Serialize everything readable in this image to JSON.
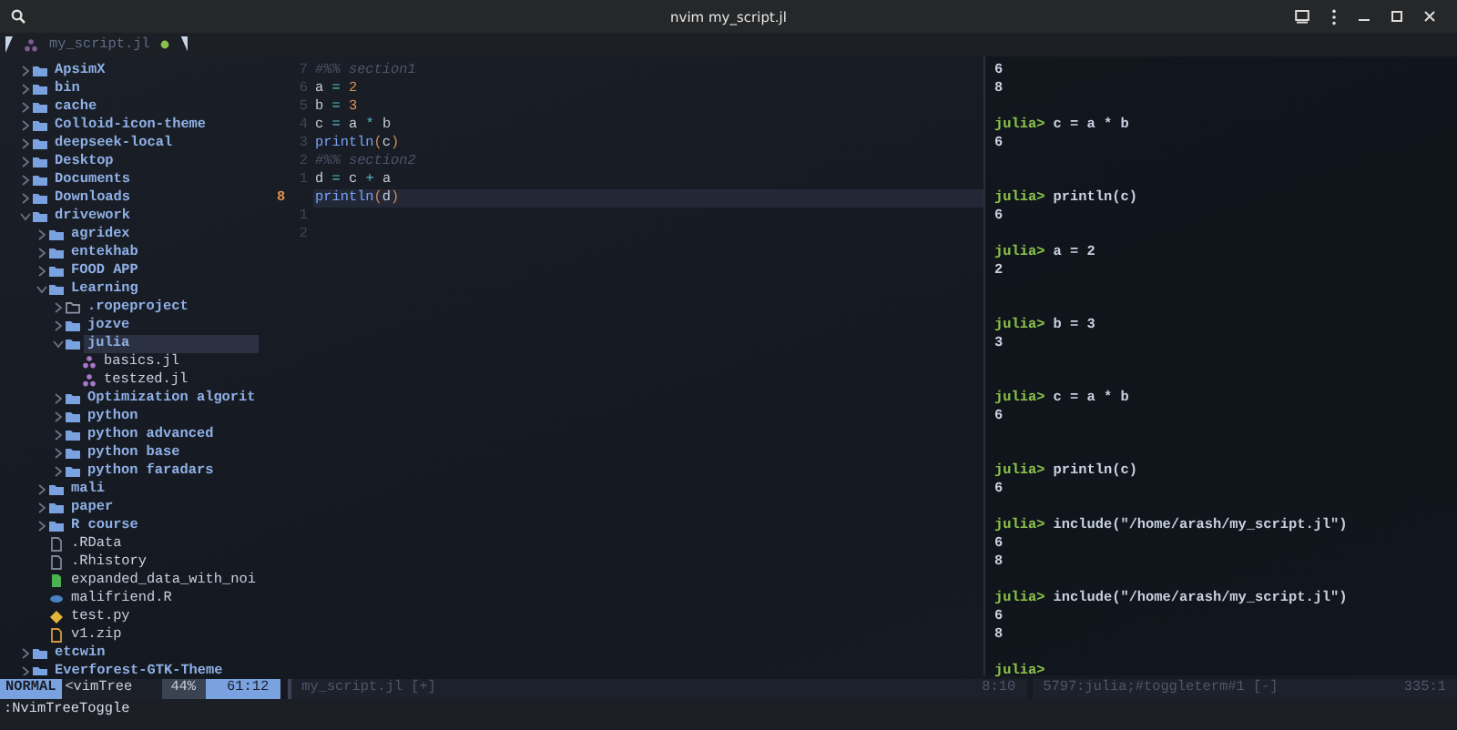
{
  "window": {
    "title": "nvim my_script.jl"
  },
  "tab": {
    "label": "my_script.jl",
    "modified": true
  },
  "tree": [
    {
      "name": "ApsimX",
      "kind": "folder",
      "expanded": false,
      "selected": false
    },
    {
      "name": "bin",
      "kind": "folder",
      "expanded": false,
      "selected": false
    },
    {
      "name": "cache",
      "kind": "folder",
      "expanded": false,
      "selected": false
    },
    {
      "name": "Colloid-icon-theme",
      "kind": "folder",
      "expanded": false,
      "selected": false
    },
    {
      "name": "deepseek-local",
      "kind": "folder",
      "expanded": false,
      "selected": false
    },
    {
      "name": "Desktop",
      "kind": "folder",
      "expanded": false,
      "selected": false
    },
    {
      "name": "Documents",
      "kind": "folder",
      "expanded": false,
      "selected": false
    },
    {
      "name": "Downloads",
      "kind": "folder",
      "expanded": false,
      "selected": false
    },
    {
      "name": "drivework",
      "kind": "folder",
      "expanded": true,
      "selected": false,
      "children": [
        {
          "name": "agridex",
          "kind": "folder",
          "expanded": false,
          "selected": false
        },
        {
          "name": "entekhab",
          "kind": "folder",
          "expanded": false,
          "selected": false
        },
        {
          "name": "FOOD APP",
          "kind": "folder",
          "expanded": false,
          "selected": false
        },
        {
          "name": "Learning",
          "kind": "folder",
          "expanded": true,
          "selected": false,
          "children": [
            {
              "name": ".ropeproject",
              "kind": "empty-folder",
              "expanded": false,
              "selected": false
            },
            {
              "name": "jozve",
              "kind": "folder",
              "expanded": false,
              "selected": false
            },
            {
              "name": "julia",
              "kind": "folder",
              "expanded": true,
              "selected": true,
              "children": [
                {
                  "name": "basics.jl",
                  "kind": "julia",
                  "selected": false
                },
                {
                  "name": "testzed.jl",
                  "kind": "julia",
                  "selected": false
                }
              ]
            },
            {
              "name": "Optimization algorit",
              "kind": "folder",
              "expanded": false,
              "selected": false
            },
            {
              "name": "python",
              "kind": "folder",
              "expanded": false,
              "selected": false
            },
            {
              "name": "python advanced",
              "kind": "folder",
              "expanded": false,
              "selected": false
            },
            {
              "name": "python base",
              "kind": "folder",
              "expanded": false,
              "selected": false
            },
            {
              "name": "python faradars",
              "kind": "folder",
              "expanded": false,
              "selected": false
            }
          ]
        },
        {
          "name": "mali",
          "kind": "folder",
          "expanded": false,
          "selected": false
        },
        {
          "name": "paper",
          "kind": "folder",
          "expanded": false,
          "selected": false
        },
        {
          "name": "R course",
          "kind": "folder",
          "expanded": false,
          "selected": false
        },
        {
          "name": ".RData",
          "kind": "data",
          "selected": false
        },
        {
          "name": ".Rhistory",
          "kind": "data",
          "selected": false
        },
        {
          "name": "expanded_data_with_noi",
          "kind": "csv",
          "selected": false
        },
        {
          "name": "malifriend.R",
          "kind": "r",
          "selected": false
        },
        {
          "name": "test.py",
          "kind": "python",
          "selected": false
        },
        {
          "name": "v1.zip",
          "kind": "zip",
          "selected": false
        }
      ]
    },
    {
      "name": "etcwin",
      "kind": "folder",
      "expanded": false,
      "selected": false
    },
    {
      "name": "Everforest-GTK-Theme",
      "kind": "folder",
      "expanded": false,
      "selected": false
    }
  ],
  "editor": {
    "lines": [
      {
        "number": "7",
        "current": false,
        "tokens": [
          {
            "text": "#%% section1",
            "kind": "comment"
          }
        ]
      },
      {
        "number": "6",
        "current": false,
        "tokens": [
          {
            "text": "a ",
            "kind": "ident"
          },
          {
            "text": "=",
            "kind": "op"
          },
          {
            "text": " 2",
            "kind": "number"
          }
        ]
      },
      {
        "number": "5",
        "current": false,
        "tokens": [
          {
            "text": "b ",
            "kind": "ident"
          },
          {
            "text": "=",
            "kind": "op"
          },
          {
            "text": " 3",
            "kind": "number"
          }
        ]
      },
      {
        "number": "4",
        "current": false,
        "tokens": [
          {
            "text": "c ",
            "kind": "ident"
          },
          {
            "text": "=",
            "kind": "op"
          },
          {
            "text": " a ",
            "kind": "ident"
          },
          {
            "text": "*",
            "kind": "op"
          },
          {
            "text": " b",
            "kind": "ident"
          }
        ]
      },
      {
        "number": "3",
        "current": false,
        "tokens": [
          {
            "text": "println",
            "kind": "func"
          },
          {
            "text": "(",
            "kind": "paren"
          },
          {
            "text": "c",
            "kind": "ident"
          },
          {
            "text": ")",
            "kind": "paren"
          }
        ]
      },
      {
        "number": "2",
        "current": false,
        "tokens": [
          {
            "text": "#%% section2",
            "kind": "comment"
          }
        ]
      },
      {
        "number": "1",
        "current": false,
        "tokens": [
          {
            "text": "d ",
            "kind": "ident"
          },
          {
            "text": "=",
            "kind": "op"
          },
          {
            "text": " c ",
            "kind": "ident"
          },
          {
            "text": "+",
            "kind": "op"
          },
          {
            "text": " a",
            "kind": "ident"
          }
        ]
      },
      {
        "number": "8",
        "current": true,
        "tokens": [
          {
            "text": "println",
            "kind": "func"
          },
          {
            "text": "(",
            "kind": "paren"
          },
          {
            "text": "d",
            "kind": "ident"
          },
          {
            "text": ")",
            "kind": "paren"
          }
        ]
      },
      {
        "number": "1",
        "current": false
      },
      {
        "number": "2",
        "current": false
      }
    ]
  },
  "terminal": {
    "lines": [
      {
        "kind": "output",
        "text": "6"
      },
      {
        "kind": "output",
        "text": "8"
      },
      {
        "kind": "blank"
      },
      {
        "kind": "input",
        "prompt": "julia>",
        "text": "c = a * b"
      },
      {
        "kind": "output",
        "text": "6"
      },
      {
        "kind": "blank"
      },
      {
        "kind": "blank"
      },
      {
        "kind": "input",
        "prompt": "julia>",
        "text": "println(c)"
      },
      {
        "kind": "output",
        "text": "6"
      },
      {
        "kind": "blank"
      },
      {
        "kind": "input",
        "prompt": "julia>",
        "text": "a = 2"
      },
      {
        "kind": "output",
        "text": "2"
      },
      {
        "kind": "blank"
      },
      {
        "kind": "blank"
      },
      {
        "kind": "input",
        "prompt": "julia>",
        "text": "b = 3"
      },
      {
        "kind": "output",
        "text": "3"
      },
      {
        "kind": "blank"
      },
      {
        "kind": "blank"
      },
      {
        "kind": "input",
        "prompt": "julia>",
        "text": "c = a * b"
      },
      {
        "kind": "output",
        "text": "6"
      },
      {
        "kind": "blank"
      },
      {
        "kind": "blank"
      },
      {
        "kind": "input",
        "prompt": "julia>",
        "text": "println(c)"
      },
      {
        "kind": "output",
        "text": "6"
      },
      {
        "kind": "blank"
      },
      {
        "kind": "input",
        "prompt": "julia>",
        "text": "include(\"/home/arash/my_script.jl\")"
      },
      {
        "kind": "output",
        "text": "6"
      },
      {
        "kind": "output",
        "text": "8"
      },
      {
        "kind": "blank"
      },
      {
        "kind": "input",
        "prompt": "julia>",
        "text": "include(\"/home/arash/my_script.jl\")"
      },
      {
        "kind": "output",
        "text": "6"
      },
      {
        "kind": "output",
        "text": "8"
      },
      {
        "kind": "blank"
      },
      {
        "kind": "input",
        "prompt": "julia>"
      }
    ]
  },
  "tree_status": {
    "mode": "NORMAL",
    "file": "<vimTree",
    "percent": "44%",
    "position": "61:12"
  },
  "editor_status": {
    "file": "my_script.jl [+]",
    "position": "8:10"
  },
  "terminal_status": {
    "name": "5797:julia;#toggleterm#1 [-]",
    "position": "335:1"
  },
  "command_line": ":NvimTreeToggle"
}
